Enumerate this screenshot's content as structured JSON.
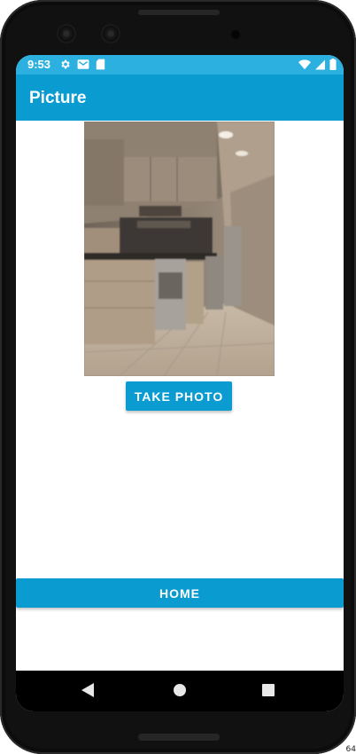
{
  "status_bar": {
    "time": "9:53",
    "left_icons": [
      "gear-icon",
      "mail-icon",
      "sd-card-icon"
    ],
    "right_icons": [
      "wifi-icon",
      "signal-icon",
      "battery-icon"
    ]
  },
  "app_bar": {
    "title": "Picture"
  },
  "photo": {
    "description_icon": "kitchen-photo"
  },
  "buttons": {
    "take_photo": "TAKE PHOTO",
    "home": "HOME"
  },
  "nav": {
    "icons": [
      "back-icon",
      "home-icon",
      "recents-icon"
    ]
  },
  "colors": {
    "accent": "#0a9bd1",
    "status_bar": "#2bb0e0"
  },
  "corner": "64"
}
